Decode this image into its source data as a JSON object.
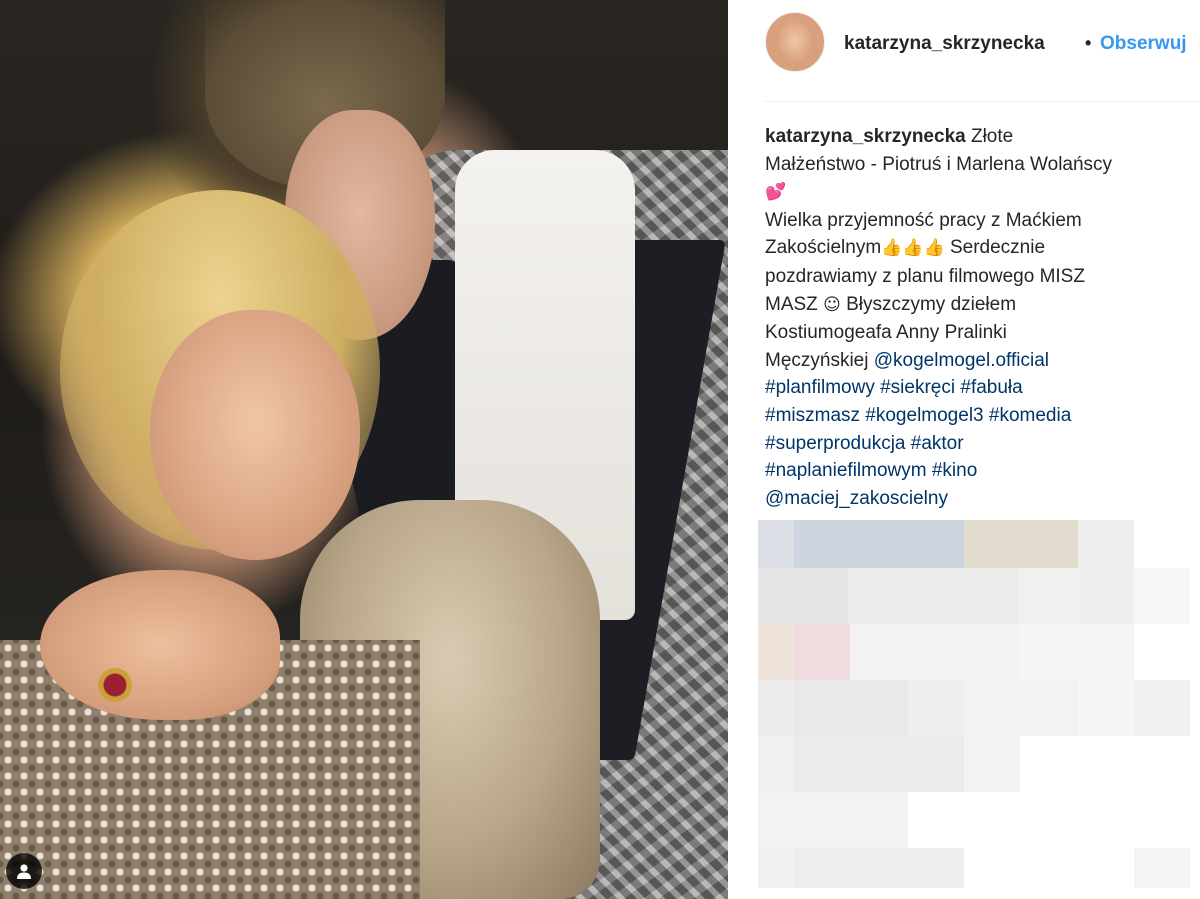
{
  "post": {
    "author_username": "katarzyna_skrzynecka",
    "separator": "•",
    "follow_label": "Obserwuj",
    "caption": {
      "author": "katarzyna_skrzynecka",
      "line1_text": " Złote",
      "line2_text": "Małżeństwo - Piotruś i Marlena Wolańscy",
      "line3_emoji": "💕",
      "line4_text": "Wielka przyjemność pracy z Maćkiem",
      "line5_text": "Zakościelnym",
      "line5_emoji": "👍👍👍",
      "line5_tail": " Serdecznie",
      "line6_text": "pozdrawiamy z planu filmowego MISZ",
      "line7_text": "MASZ ",
      "line7_emoji": "☺",
      "line7_tail": " Błyszczymy dziełem",
      "line8_text": "Kostiumogeafa Anny Pralinki",
      "line9_text": "Męczyńskiej ",
      "mention_1": "@kogelmogel.official",
      "hashtags": {
        "planfilmowy": "#planfilmowy",
        "siekreci": "#siekręci",
        "fabula": "#fabuła",
        "miszmasz": "#miszmasz",
        "kogelmogel3": "#kogelmogel3",
        "komedia": "#komedia",
        "superprodukcja": "#superprodukcja",
        "aktor": "#aktor",
        "naplaniefilmowym": "#naplaniefilmowym",
        "kino": "#kino"
      },
      "mention_2": "@maciej_zakoscielny"
    }
  },
  "icons": {
    "user_tag": "user-tag-icon",
    "avatar": "profile-avatar"
  },
  "colors": {
    "link": "#003569",
    "follow": "#3897f0",
    "text": "#262626",
    "divider": "#efefef"
  }
}
